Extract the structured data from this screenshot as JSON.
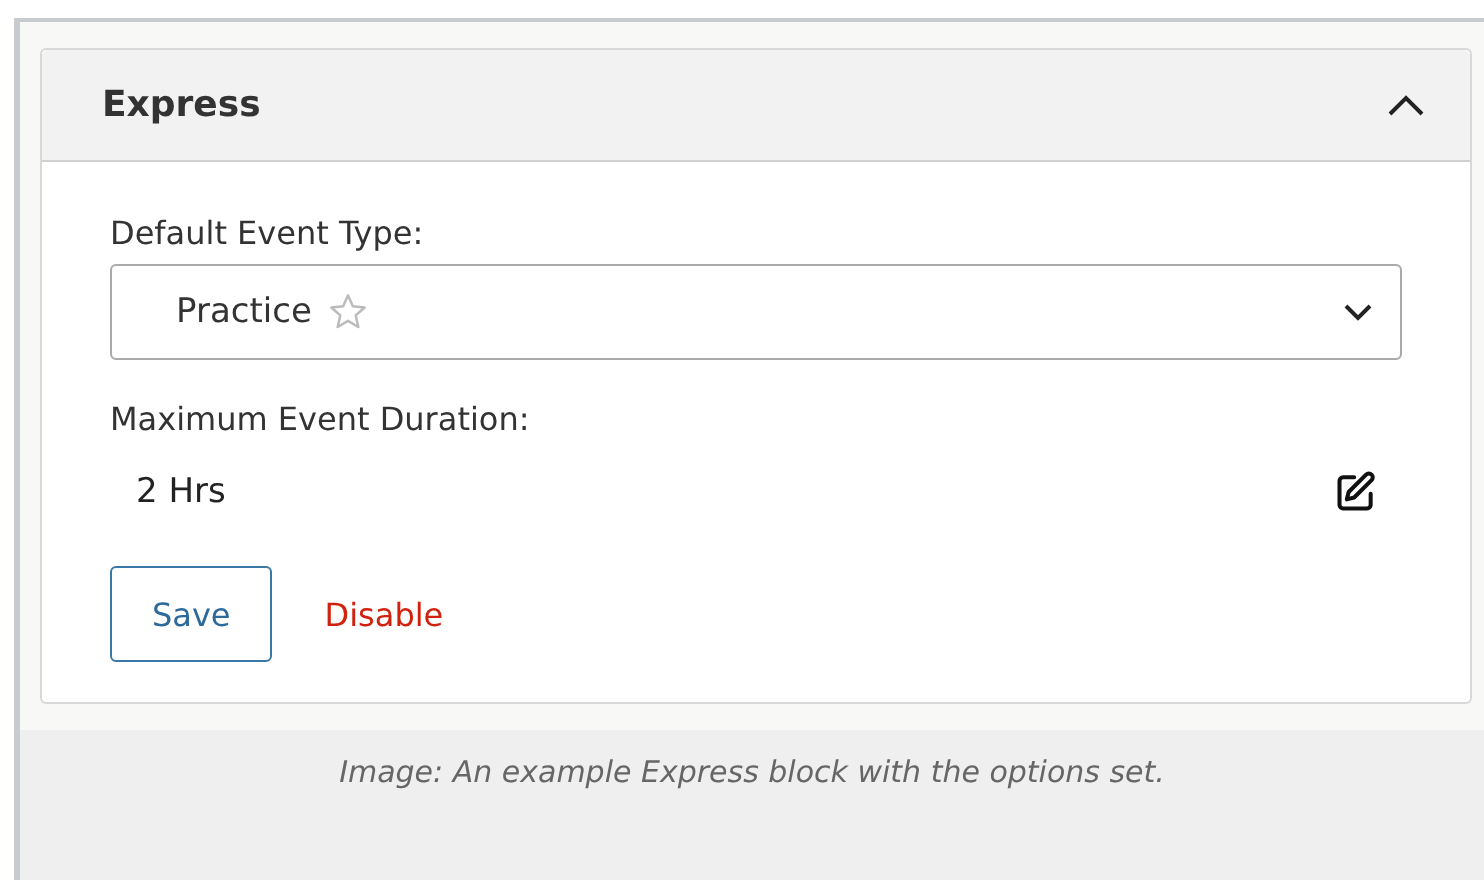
{
  "panel": {
    "title": "Express",
    "expanded": true
  },
  "event_type": {
    "label": "Default Event Type:",
    "value": "Practice",
    "favorite": false
  },
  "duration": {
    "label": "Maximum Event Duration:",
    "value": "2 Hrs"
  },
  "buttons": [
    {
      "label": "Save",
      "kind": "outline"
    },
    {
      "label": "Disable",
      "kind": "danger-link"
    }
  ],
  "caption": "Image: An example Express block with the options set."
}
